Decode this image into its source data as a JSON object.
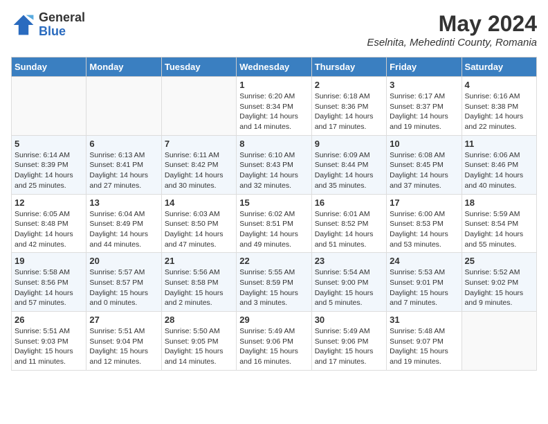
{
  "header": {
    "logo_general": "General",
    "logo_blue": "Blue",
    "title": "May 2024",
    "subtitle": "Eselnita, Mehedinti County, Romania"
  },
  "calendar": {
    "days_of_week": [
      "Sunday",
      "Monday",
      "Tuesday",
      "Wednesday",
      "Thursday",
      "Friday",
      "Saturday"
    ],
    "weeks": [
      [
        {
          "day": "",
          "info": ""
        },
        {
          "day": "",
          "info": ""
        },
        {
          "day": "",
          "info": ""
        },
        {
          "day": "1",
          "info": "Sunrise: 6:20 AM\nSunset: 8:34 PM\nDaylight: 14 hours and 14 minutes."
        },
        {
          "day": "2",
          "info": "Sunrise: 6:18 AM\nSunset: 8:36 PM\nDaylight: 14 hours and 17 minutes."
        },
        {
          "day": "3",
          "info": "Sunrise: 6:17 AM\nSunset: 8:37 PM\nDaylight: 14 hours and 19 minutes."
        },
        {
          "day": "4",
          "info": "Sunrise: 6:16 AM\nSunset: 8:38 PM\nDaylight: 14 hours and 22 minutes."
        }
      ],
      [
        {
          "day": "5",
          "info": "Sunrise: 6:14 AM\nSunset: 8:39 PM\nDaylight: 14 hours and 25 minutes."
        },
        {
          "day": "6",
          "info": "Sunrise: 6:13 AM\nSunset: 8:41 PM\nDaylight: 14 hours and 27 minutes."
        },
        {
          "day": "7",
          "info": "Sunrise: 6:11 AM\nSunset: 8:42 PM\nDaylight: 14 hours and 30 minutes."
        },
        {
          "day": "8",
          "info": "Sunrise: 6:10 AM\nSunset: 8:43 PM\nDaylight: 14 hours and 32 minutes."
        },
        {
          "day": "9",
          "info": "Sunrise: 6:09 AM\nSunset: 8:44 PM\nDaylight: 14 hours and 35 minutes."
        },
        {
          "day": "10",
          "info": "Sunrise: 6:08 AM\nSunset: 8:45 PM\nDaylight: 14 hours and 37 minutes."
        },
        {
          "day": "11",
          "info": "Sunrise: 6:06 AM\nSunset: 8:46 PM\nDaylight: 14 hours and 40 minutes."
        }
      ],
      [
        {
          "day": "12",
          "info": "Sunrise: 6:05 AM\nSunset: 8:48 PM\nDaylight: 14 hours and 42 minutes."
        },
        {
          "day": "13",
          "info": "Sunrise: 6:04 AM\nSunset: 8:49 PM\nDaylight: 14 hours and 44 minutes."
        },
        {
          "day": "14",
          "info": "Sunrise: 6:03 AM\nSunset: 8:50 PM\nDaylight: 14 hours and 47 minutes."
        },
        {
          "day": "15",
          "info": "Sunrise: 6:02 AM\nSunset: 8:51 PM\nDaylight: 14 hours and 49 minutes."
        },
        {
          "day": "16",
          "info": "Sunrise: 6:01 AM\nSunset: 8:52 PM\nDaylight: 14 hours and 51 minutes."
        },
        {
          "day": "17",
          "info": "Sunrise: 6:00 AM\nSunset: 8:53 PM\nDaylight: 14 hours and 53 minutes."
        },
        {
          "day": "18",
          "info": "Sunrise: 5:59 AM\nSunset: 8:54 PM\nDaylight: 14 hours and 55 minutes."
        }
      ],
      [
        {
          "day": "19",
          "info": "Sunrise: 5:58 AM\nSunset: 8:56 PM\nDaylight: 14 hours and 57 minutes."
        },
        {
          "day": "20",
          "info": "Sunrise: 5:57 AM\nSunset: 8:57 PM\nDaylight: 15 hours and 0 minutes."
        },
        {
          "day": "21",
          "info": "Sunrise: 5:56 AM\nSunset: 8:58 PM\nDaylight: 15 hours and 2 minutes."
        },
        {
          "day": "22",
          "info": "Sunrise: 5:55 AM\nSunset: 8:59 PM\nDaylight: 15 hours and 3 minutes."
        },
        {
          "day": "23",
          "info": "Sunrise: 5:54 AM\nSunset: 9:00 PM\nDaylight: 15 hours and 5 minutes."
        },
        {
          "day": "24",
          "info": "Sunrise: 5:53 AM\nSunset: 9:01 PM\nDaylight: 15 hours and 7 minutes."
        },
        {
          "day": "25",
          "info": "Sunrise: 5:52 AM\nSunset: 9:02 PM\nDaylight: 15 hours and 9 minutes."
        }
      ],
      [
        {
          "day": "26",
          "info": "Sunrise: 5:51 AM\nSunset: 9:03 PM\nDaylight: 15 hours and 11 minutes."
        },
        {
          "day": "27",
          "info": "Sunrise: 5:51 AM\nSunset: 9:04 PM\nDaylight: 15 hours and 12 minutes."
        },
        {
          "day": "28",
          "info": "Sunrise: 5:50 AM\nSunset: 9:05 PM\nDaylight: 15 hours and 14 minutes."
        },
        {
          "day": "29",
          "info": "Sunrise: 5:49 AM\nSunset: 9:06 PM\nDaylight: 15 hours and 16 minutes."
        },
        {
          "day": "30",
          "info": "Sunrise: 5:49 AM\nSunset: 9:06 PM\nDaylight: 15 hours and 17 minutes."
        },
        {
          "day": "31",
          "info": "Sunrise: 5:48 AM\nSunset: 9:07 PM\nDaylight: 15 hours and 19 minutes."
        },
        {
          "day": "",
          "info": ""
        }
      ]
    ]
  }
}
